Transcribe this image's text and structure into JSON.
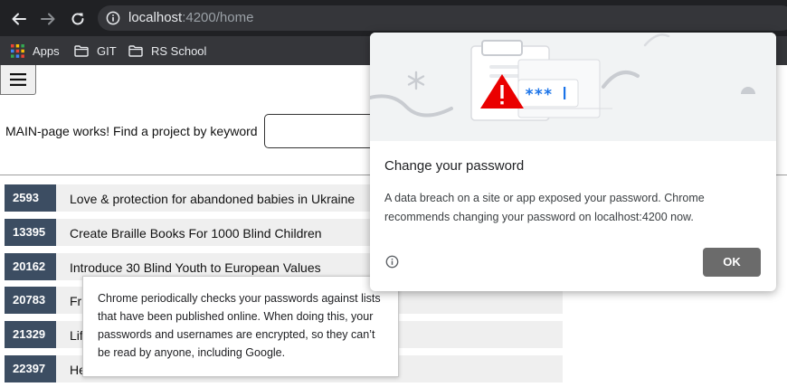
{
  "browser": {
    "url_host": "localhost",
    "url_rest": ":4200/home",
    "bookmarks": [
      {
        "label": "Apps",
        "icon": "apps-grid-icon"
      },
      {
        "label": "GIT",
        "icon": "folder-icon"
      },
      {
        "label": "RS School",
        "icon": "folder-icon"
      }
    ]
  },
  "page": {
    "search_label": "MAIN-page works! Find a project by keyword",
    "search_value": "",
    "projects": [
      {
        "id": "2593",
        "title": "Love & protection for abandoned babies in Ukraine"
      },
      {
        "id": "13395",
        "title": "Create Braille Books For 1000 Blind Children"
      },
      {
        "id": "20162",
        "title": "Introduce 30 Blind Youth to European Values"
      },
      {
        "id": "20783",
        "title": "Fr"
      },
      {
        "id": "21329",
        "title": "Lif"
      },
      {
        "id": "22397",
        "title": "He"
      }
    ]
  },
  "tooltip": {
    "text": "Chrome periodically checks your passwords against lists that have been published online. When doing this, your passwords and usernames are encrypted, so they can’t be read by anyone, including Google."
  },
  "dialog": {
    "title": "Change your password",
    "body": "A data breach on a site or app exposed your password. Chrome recommends changing your password on localhost:4200 now.",
    "ok_label": "OK",
    "password_mask": "***"
  },
  "colors": {
    "chrome_dark": "#202124",
    "chrome_bar": "#35363a",
    "id_badge": "#3c4d62",
    "row_bg": "#efefef",
    "ok_button": "#6b6b6b",
    "warning_red": "#ea0000",
    "mask_blue": "#1a73e8"
  }
}
